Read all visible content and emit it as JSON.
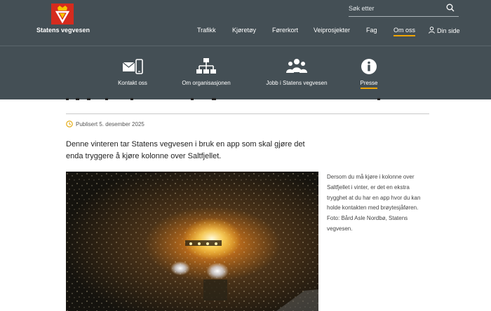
{
  "brand": {
    "name": "Statens vegvesen"
  },
  "search": {
    "placeholder": "Søk etter"
  },
  "main_nav": [
    {
      "label": "Trafikk"
    },
    {
      "label": "Kjøretøy"
    },
    {
      "label": "Førerkort"
    },
    {
      "label": "Veiprosjekter"
    },
    {
      "label": "Fag"
    },
    {
      "label": "Om oss",
      "active": true
    },
    {
      "label": "Din side"
    }
  ],
  "sub_nav": [
    {
      "label": "Kontakt oss",
      "icon": "contact-icon"
    },
    {
      "label": "Om organisasjonen",
      "icon": "org-chart-icon"
    },
    {
      "label": "Jobb i Statens vegvesen",
      "icon": "people-icon"
    },
    {
      "label": "Presse",
      "icon": "info-icon",
      "active": true
    }
  ],
  "article": {
    "published": "Publisert 5. desember 2025",
    "lead": "Denne vinteren tar Statens vegvesen i bruk en app som skal gjøre det enda tryggere å kjøre kolonne over Saltfjellet.",
    "image_caption": "Dersom du må kjøre i kolonne over Saltfjellet i vinter, er det en ekstra trygghet at du har en app hvor du kan holde kontakten med brøytesjåføren. Foto: Bård Asle Nordbø, Statens vegvesen."
  },
  "colors": {
    "header_bg": "#444f55",
    "accent": "#f0a500",
    "logo_red": "#d52b1e"
  }
}
